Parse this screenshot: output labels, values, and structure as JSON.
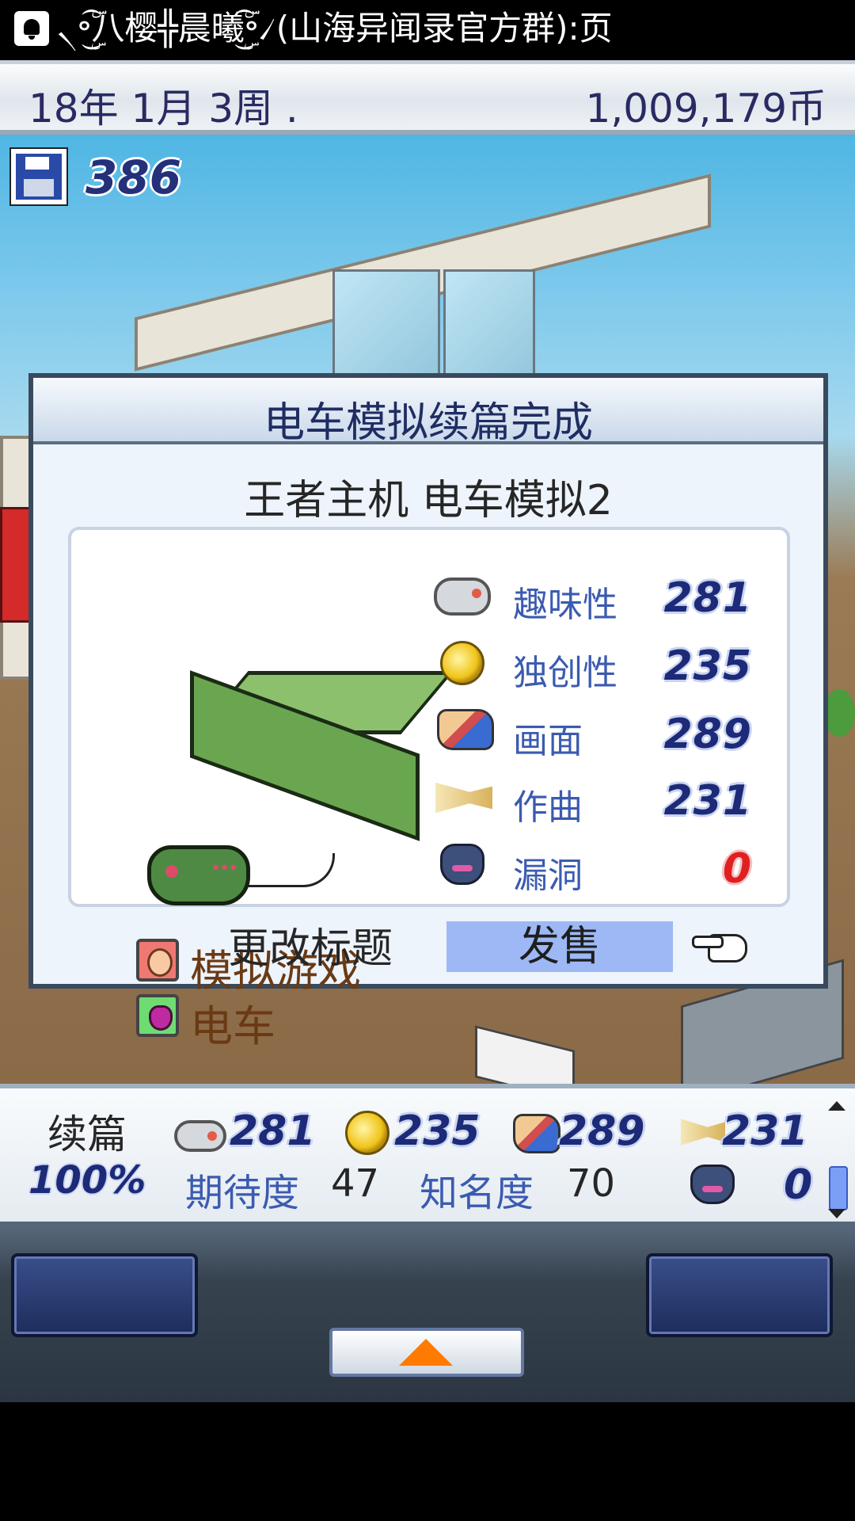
{
  "statusbar": {
    "notification_text": "৲॰ۣۜۜ͜͡八樱╬晨曦ۣۜۜ͜͡॰৴(山海异闻录官方群):页"
  },
  "header": {
    "date": "18年 1月 3周 .",
    "money": "1,009,179币"
  },
  "save": {
    "count": "386"
  },
  "dialog": {
    "title": "电车模拟续篇完成",
    "game_title": "王者主机 电车模拟2",
    "genres": [
      {
        "label": "模拟游戏"
      },
      {
        "label": "电车"
      }
    ],
    "stats": [
      {
        "icon": "gamepad-icon",
        "label": "趣味性",
        "value": "281"
      },
      {
        "icon": "lightbulb-icon",
        "label": "独创性",
        "value": "235"
      },
      {
        "icon": "paint-palette-icon",
        "label": "画面",
        "value": "289"
      },
      {
        "icon": "trumpet-icon",
        "label": "作曲",
        "value": "231"
      },
      {
        "icon": "bug-icon",
        "label": "漏洞",
        "value": "0"
      }
    ],
    "rename_button": "更改标题",
    "sell_button": "发售"
  },
  "bottom_panel": {
    "sequel_label": "续篇",
    "progress": "100%",
    "stats": [
      "281",
      "235",
      "289",
      "231"
    ],
    "expectation_label": "期待度",
    "expectation_value": "47",
    "fame_label": "知名度",
    "fame_value": "70",
    "bugs_value": "0"
  },
  "colors": {
    "sell_highlight": "#9db8f4",
    "stat_label": "#3b5bb0",
    "stat_value": "#1c2a78",
    "bug_value": "#e02020"
  }
}
